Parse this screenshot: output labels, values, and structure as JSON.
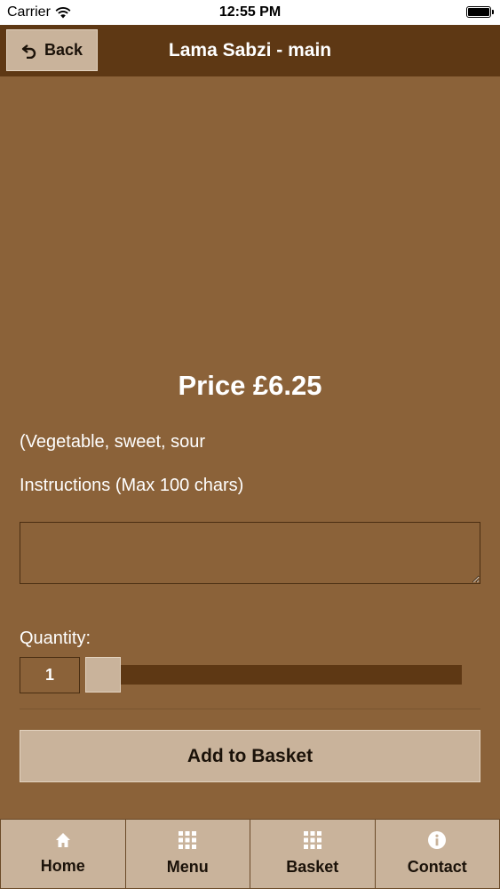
{
  "status_bar": {
    "carrier": "Carrier",
    "time": "12:55 PM"
  },
  "header": {
    "back_label": "Back",
    "title": "Lama Sabzi - main"
  },
  "product": {
    "price": "Price £6.25",
    "description": "(Vegetable, sweet, sour",
    "instructions_label": "Instructions (Max 100 chars)",
    "instructions_value": "",
    "quantity_label": "Quantity:",
    "quantity": "1",
    "add_button_label": "Add to Basket"
  },
  "tabs": [
    {
      "label": "Home",
      "icon": "home-icon"
    },
    {
      "label": "Menu",
      "icon": "grid-icon"
    },
    {
      "label": "Basket",
      "icon": "grid-icon"
    },
    {
      "label": "Contact",
      "icon": "info-icon"
    }
  ],
  "colors": {
    "background": "#8b6239",
    "header": "#5e3814",
    "button": "#c9b39b",
    "text_light": "#ffffff",
    "text_dark": "#1b1209"
  }
}
